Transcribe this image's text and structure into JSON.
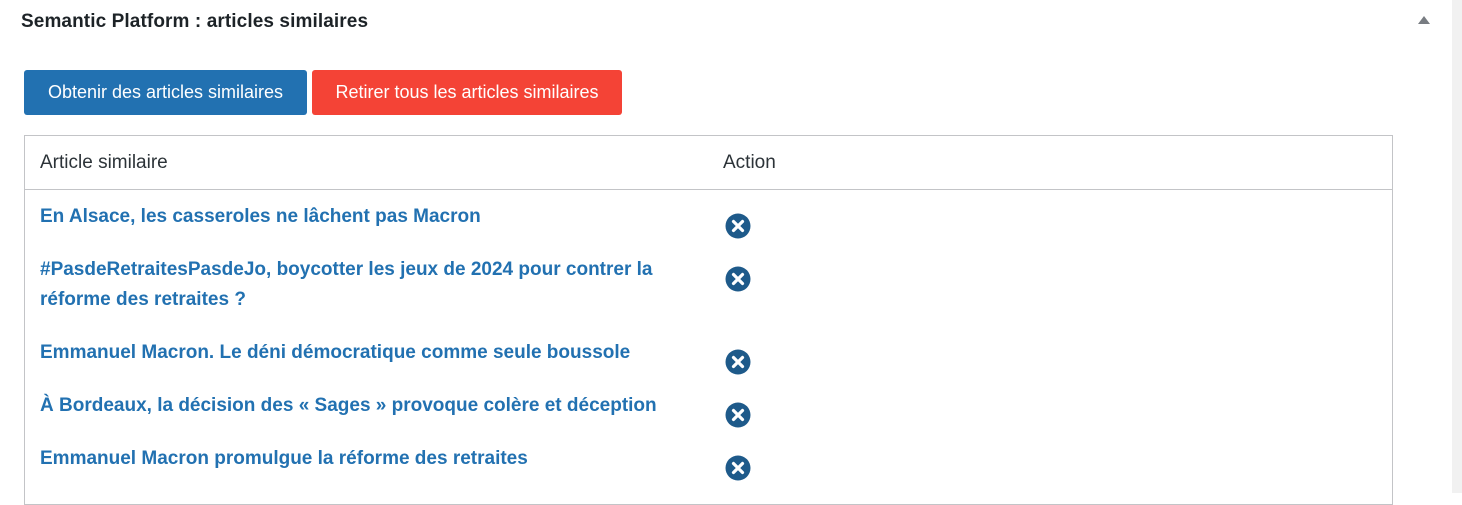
{
  "panel": {
    "title": "Semantic Platform : articles similaires",
    "toggle_icon": "triangle-up-icon"
  },
  "toolbar": {
    "get_label": "Obtenir des articles similaires",
    "remove_all_label": "Retirer tous les articles similaires",
    "primary_color": "#2271b1",
    "danger_color": "#f44336"
  },
  "table": {
    "headers": {
      "article": "Article similaire",
      "action": "Action"
    },
    "rows": [
      {
        "title": "En Alsace, les casseroles ne lâchent pas Macron",
        "action_icon": "remove-circle-icon"
      },
      {
        "title": "#PasdeRetraitesPasdeJo, boycotter les jeux de 2024 pour contrer la réforme des retraites ?",
        "action_icon": "remove-circle-icon"
      },
      {
        "title": "Emmanuel Macron. Le déni démocratique comme seule boussole",
        "action_icon": "remove-circle-icon"
      },
      {
        "title": "À Bordeaux, la décision des « Sages » provoque colère et déception",
        "action_icon": "remove-circle-icon"
      },
      {
        "title": "Emmanuel Macron promulgue la réforme des retraites",
        "action_icon": "remove-circle-icon"
      }
    ]
  }
}
